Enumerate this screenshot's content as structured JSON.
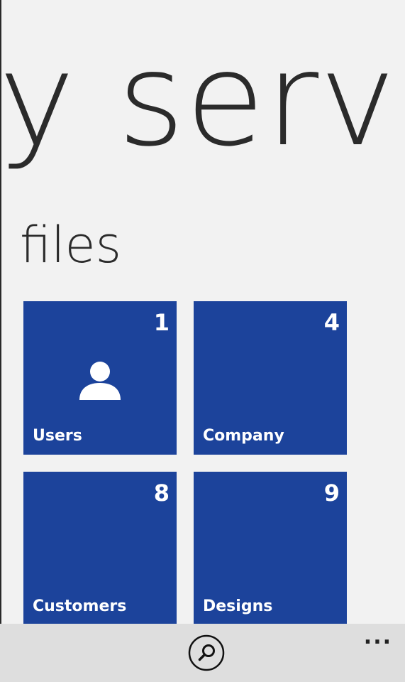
{
  "hub": {
    "title": "y serve"
  },
  "section": {
    "title": "files"
  },
  "tiles": [
    {
      "label": "Users",
      "count": "1",
      "icon": "person-icon"
    },
    {
      "label": "Company",
      "count": "4"
    },
    {
      "label": "Customers",
      "count": "8"
    },
    {
      "label": "Designs",
      "count": "9"
    }
  ],
  "app_bar": {
    "search_icon": "search-icon",
    "more_label": "..."
  },
  "colors": {
    "tile": "#1c439b",
    "background": "#f2f2f2",
    "app_bar": "#dedede",
    "text": "#2b2b2b"
  }
}
